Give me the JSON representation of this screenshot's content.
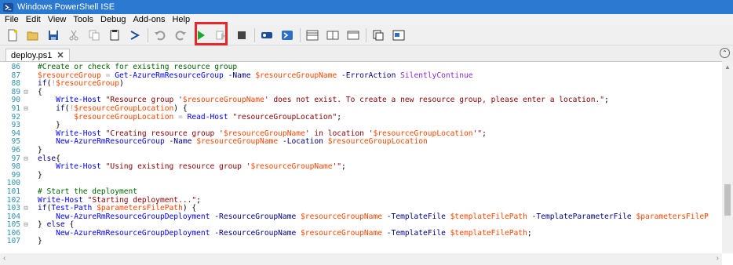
{
  "window": {
    "title": "Windows PowerShell ISE"
  },
  "menu": {
    "items": [
      "File",
      "Edit",
      "View",
      "Tools",
      "Debug",
      "Add-ons",
      "Help"
    ]
  },
  "toolbar": {
    "buttons": [
      "new-icon",
      "open-icon",
      "save-icon",
      "cut-icon",
      "copy-icon",
      "paste-icon",
      "clear-console-icon",
      "undo-icon",
      "redo-icon",
      "run-icon",
      "run-selection-icon",
      "stop-icon",
      "remote-powershell-icon",
      "powershell-console-icon",
      "show-script-top-icon",
      "show-script-right-icon",
      "show-script-max-icon",
      "command-addon-icon",
      "show-command-window-icon"
    ],
    "highlight_color": "#e6262b"
  },
  "tab": {
    "label": "deploy.ps1",
    "close": "✕"
  },
  "editor": {
    "lines": [
      {
        "n": "86",
        "fold": "",
        "tokens": [
          {
            "t": "#Create or check for existing resource group",
            "c": "#006400"
          }
        ]
      },
      {
        "n": "87",
        "fold": "",
        "tokens": [
          {
            "t": "$resourceGroup",
            "c": "#ff4500"
          },
          {
            "t": " = ",
            "c": "#a9a9a9"
          },
          {
            "t": "Get-AzureRmResourceGroup",
            "c": "#0000ff"
          },
          {
            "t": " ",
            "c": "#000"
          },
          {
            "t": "-Name",
            "c": "#000080"
          },
          {
            "t": " ",
            "c": "#000"
          },
          {
            "t": "$resourceGroupName",
            "c": "#ff4500"
          },
          {
            "t": " ",
            "c": "#000"
          },
          {
            "t": "-ErrorAction",
            "c": "#000080"
          },
          {
            "t": " ",
            "c": "#000"
          },
          {
            "t": "SilentlyContinue",
            "c": "#8a2be2"
          }
        ]
      },
      {
        "n": "88",
        "fold": "",
        "tokens": [
          {
            "t": "if",
            "c": "#00008b"
          },
          {
            "t": "(",
            "c": "#000"
          },
          {
            "t": "!",
            "c": "#a9a9a9"
          },
          {
            "t": "$resourceGroup",
            "c": "#ff4500"
          },
          {
            "t": ")",
            "c": "#000"
          }
        ]
      },
      {
        "n": "89",
        "fold": "⊟",
        "tokens": [
          {
            "t": "{",
            "c": "#000"
          }
        ]
      },
      {
        "n": "90",
        "fold": "",
        "tokens": [
          {
            "t": "    Write-Host",
            "c": "#0000ff"
          },
          {
            "t": " ",
            "c": "#000"
          },
          {
            "t": "\"Resource group '",
            "c": "#8b0000"
          },
          {
            "t": "$resourceGroupName",
            "c": "#ff4500"
          },
          {
            "t": "' does not exist. To create a new resource group, please enter a location.\"",
            "c": "#8b0000"
          },
          {
            "t": ";",
            "c": "#000"
          }
        ]
      },
      {
        "n": "91",
        "fold": "⊟",
        "tokens": [
          {
            "t": "    if",
            "c": "#00008b"
          },
          {
            "t": "(",
            "c": "#000"
          },
          {
            "t": "!",
            "c": "#a9a9a9"
          },
          {
            "t": "$resourceGroupLocation",
            "c": "#ff4500"
          },
          {
            "t": ") {",
            "c": "#000"
          }
        ]
      },
      {
        "n": "92",
        "fold": "",
        "tokens": [
          {
            "t": "        $resourceGroupLocation",
            "c": "#ff4500"
          },
          {
            "t": " = ",
            "c": "#a9a9a9"
          },
          {
            "t": "Read-Host",
            "c": "#0000ff"
          },
          {
            "t": " ",
            "c": "#000"
          },
          {
            "t": "\"resourceGroupLocation\"",
            "c": "#8b0000"
          },
          {
            "t": ";",
            "c": "#000"
          }
        ]
      },
      {
        "n": "93",
        "fold": "",
        "tokens": [
          {
            "t": "    }",
            "c": "#000"
          }
        ]
      },
      {
        "n": "94",
        "fold": "",
        "tokens": [
          {
            "t": "    Write-Host",
            "c": "#0000ff"
          },
          {
            "t": " ",
            "c": "#000"
          },
          {
            "t": "\"Creating resource group '",
            "c": "#8b0000"
          },
          {
            "t": "$resourceGroupName",
            "c": "#ff4500"
          },
          {
            "t": "' in location '",
            "c": "#8b0000"
          },
          {
            "t": "$resourceGroupLocation",
            "c": "#ff4500"
          },
          {
            "t": "'\"",
            "c": "#8b0000"
          },
          {
            "t": ";",
            "c": "#000"
          }
        ]
      },
      {
        "n": "95",
        "fold": "",
        "tokens": [
          {
            "t": "    New-AzureRmResourceGroup",
            "c": "#0000ff"
          },
          {
            "t": " ",
            "c": "#000"
          },
          {
            "t": "-Name",
            "c": "#000080"
          },
          {
            "t": " ",
            "c": "#000"
          },
          {
            "t": "$resourceGroupName",
            "c": "#ff4500"
          },
          {
            "t": " ",
            "c": "#000"
          },
          {
            "t": "-Location",
            "c": "#000080"
          },
          {
            "t": " ",
            "c": "#000"
          },
          {
            "t": "$resourceGroupLocation",
            "c": "#ff4500"
          }
        ]
      },
      {
        "n": "96",
        "fold": "",
        "tokens": [
          {
            "t": "}",
            "c": "#000"
          }
        ]
      },
      {
        "n": "97",
        "fold": "⊟",
        "tokens": [
          {
            "t": "else",
            "c": "#00008b"
          },
          {
            "t": "{",
            "c": "#000"
          }
        ]
      },
      {
        "n": "98",
        "fold": "",
        "tokens": [
          {
            "t": "    Write-Host",
            "c": "#0000ff"
          },
          {
            "t": " ",
            "c": "#000"
          },
          {
            "t": "\"Using existing resource group '",
            "c": "#8b0000"
          },
          {
            "t": "$resourceGroupName",
            "c": "#ff4500"
          },
          {
            "t": "'\"",
            "c": "#8b0000"
          },
          {
            "t": ";",
            "c": "#000"
          }
        ]
      },
      {
        "n": "99",
        "fold": "",
        "tokens": [
          {
            "t": "}",
            "c": "#000"
          }
        ]
      },
      {
        "n": "100",
        "fold": "",
        "tokens": []
      },
      {
        "n": "101",
        "fold": "",
        "tokens": [
          {
            "t": "# Start the deployment",
            "c": "#006400"
          }
        ]
      },
      {
        "n": "102",
        "fold": "",
        "tokens": [
          {
            "t": "Write-Host",
            "c": "#0000ff"
          },
          {
            "t": " ",
            "c": "#000"
          },
          {
            "t": "\"Starting deployment...\"",
            "c": "#8b0000"
          },
          {
            "t": ";",
            "c": "#000"
          }
        ]
      },
      {
        "n": "103",
        "fold": "⊟",
        "tokens": [
          {
            "t": "if",
            "c": "#00008b"
          },
          {
            "t": "(",
            "c": "#000"
          },
          {
            "t": "Test-Path",
            "c": "#0000ff"
          },
          {
            "t": " ",
            "c": "#000"
          },
          {
            "t": "$parametersFilePath",
            "c": "#ff4500"
          },
          {
            "t": ") {",
            "c": "#000"
          }
        ]
      },
      {
        "n": "104",
        "fold": "",
        "tokens": [
          {
            "t": "    New-AzureRmResourceGroupDeployment",
            "c": "#0000ff"
          },
          {
            "t": " ",
            "c": "#000"
          },
          {
            "t": "-ResourceGroupName",
            "c": "#000080"
          },
          {
            "t": " ",
            "c": "#000"
          },
          {
            "t": "$resourceGroupName",
            "c": "#ff4500"
          },
          {
            "t": " ",
            "c": "#000"
          },
          {
            "t": "-TemplateFile",
            "c": "#000080"
          },
          {
            "t": " ",
            "c": "#000"
          },
          {
            "t": "$templateFilePath",
            "c": "#ff4500"
          },
          {
            "t": " ",
            "c": "#000"
          },
          {
            "t": "-TemplateParameterFile",
            "c": "#000080"
          },
          {
            "t": " ",
            "c": "#000"
          },
          {
            "t": "$parametersFileP",
            "c": "#ff4500"
          }
        ]
      },
      {
        "n": "105",
        "fold": "⊟",
        "tokens": [
          {
            "t": "} ",
            "c": "#000"
          },
          {
            "t": "else",
            "c": "#00008b"
          },
          {
            "t": " {",
            "c": "#000"
          }
        ]
      },
      {
        "n": "106",
        "fold": "",
        "tokens": [
          {
            "t": "    New-AzureRmResourceGroupDeployment",
            "c": "#0000ff"
          },
          {
            "t": " ",
            "c": "#000"
          },
          {
            "t": "-ResourceGroupName",
            "c": "#000080"
          },
          {
            "t": " ",
            "c": "#000"
          },
          {
            "t": "$resourceGroupName",
            "c": "#ff4500"
          },
          {
            "t": " ",
            "c": "#000"
          },
          {
            "t": "-TemplateFile",
            "c": "#000080"
          },
          {
            "t": " ",
            "c": "#000"
          },
          {
            "t": "$templateFilePath",
            "c": "#ff4500"
          },
          {
            "t": ";",
            "c": "#000"
          }
        ]
      },
      {
        "n": "107",
        "fold": "",
        "tokens": [
          {
            "t": "}",
            "c": "#000"
          }
        ]
      }
    ]
  }
}
